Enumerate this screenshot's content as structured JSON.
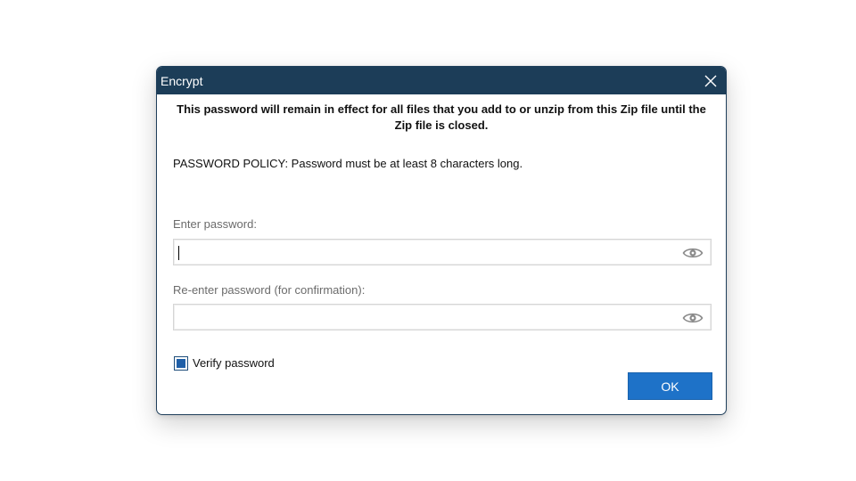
{
  "dialog": {
    "title": "Encrypt",
    "close_icon": "close-icon",
    "notice": "This password will remain in effect for all files that you add to or unzip from this Zip file until the Zip file is closed.",
    "policy": "PASSWORD POLICY: Password must be at least 8 characters long.",
    "password": {
      "label": "Enter password:",
      "value": "",
      "icon": "eye-icon"
    },
    "confirm": {
      "label": "Re-enter password (for confirmation):",
      "value": "",
      "icon": "eye-icon"
    },
    "verify": {
      "label": "Verify password",
      "checked": true
    },
    "ok_label": "OK"
  },
  "colors": {
    "titlebar": "#1c3d58",
    "accent": "#1e72c8",
    "checkbox_fill": "#1f5fa8"
  }
}
